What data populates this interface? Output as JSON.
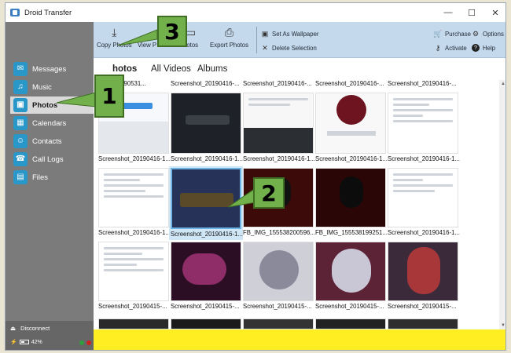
{
  "window": {
    "title": "Droid Transfer"
  },
  "window_controls": {
    "minimize": "—",
    "maximize": "☐",
    "close": "✕"
  },
  "sidebar": {
    "items": [
      {
        "label": "Messages",
        "icon": "chat-icon"
      },
      {
        "label": "Music",
        "icon": "music-icon"
      },
      {
        "label": "Photos",
        "icon": "photo-icon",
        "active": true
      },
      {
        "label": "Calendars",
        "icon": "calendar-icon"
      },
      {
        "label": "Contacts",
        "icon": "contacts-icon"
      },
      {
        "label": "Call Logs",
        "icon": "phone-icon"
      },
      {
        "label": "Files",
        "icon": "files-icon"
      }
    ],
    "disconnect_label": "Disconnect",
    "battery_label": "42%",
    "status_colors": [
      "#2e9e3e",
      "#cc2222"
    ]
  },
  "toolbar": {
    "copy_photos": "Copy Photos",
    "view_photos": "View P",
    "photos_partial": "hotos",
    "export_photos": "Export Photos",
    "set_wallpaper": "Set As Wallpaper",
    "delete_selection": "Delete Selection",
    "purchase": "Purchase",
    "options": "Options",
    "activate": "Activate",
    "help": "Help"
  },
  "tabs": [
    {
      "label": "hotos",
      "active": true
    },
    {
      "label": "All Videos"
    },
    {
      "label": "Albums"
    }
  ],
  "grid": {
    "top_row_captions": [
      "...0417_090531...",
      "Screenshot_20190416-...",
      "Screenshot_20190416-...",
      "Screenshot_20190416-...",
      "Screenshot_20190416-..."
    ],
    "row1_captions": [
      "Screenshot_20190416-1...",
      "Screenshot_20190416-1...",
      "Screenshot_20190416-1...",
      "Screenshot_20190416-1...",
      "Screenshot_20190416-1..."
    ],
    "row2_captions": [
      "Screenshot_20190416-1...",
      "Screenshot_20190416-1...",
      "FB_IMG_155538200596...",
      "FB_IMG_155538199251...",
      "Screenshot_20190416-1..."
    ],
    "row3_captions": [
      "Screenshot_20190415-...",
      "Screenshot_20190415-...",
      "Screenshot_20190415-...",
      "Screenshot_20190415-...",
      "Screenshot_20190415-..."
    ]
  },
  "callouts": [
    "1",
    "2",
    "3"
  ],
  "colors": {
    "sidebar": "#7b7b7b",
    "toolbar": "#c5d9ec",
    "accent_icon": "#2a97c9",
    "footer": "#ffee22",
    "callout": "#72b04b"
  }
}
